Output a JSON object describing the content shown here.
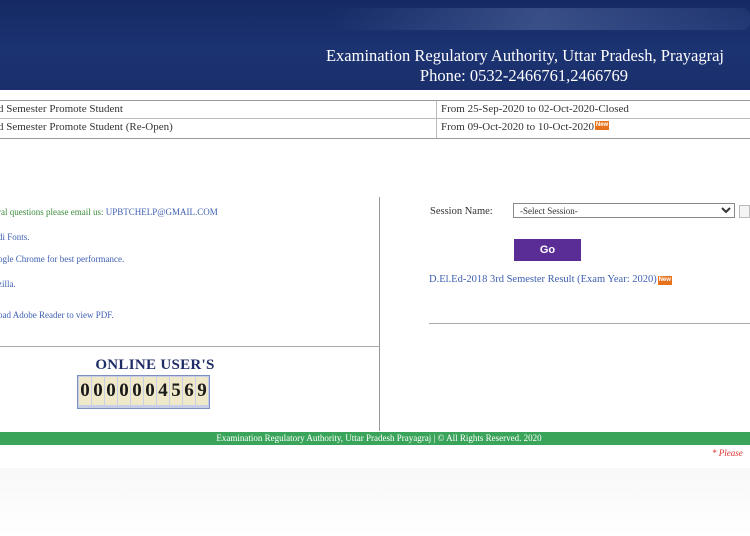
{
  "header": {
    "title": "Examination Regulatory Authority, Uttar Pradesh, Prayagraj",
    "phone": "Phone: 0532-2466761,2466769"
  },
  "schedule": [
    {
      "label": "d Semester Promote Student",
      "dates": "From 25-Sep-2020 to 02-Oct-2020-Closed",
      "new": false
    },
    {
      "label": "d Semester Promote Student (Re-Open)",
      "dates": "From 09-Oct-2020 to 10-Oct-2020",
      "new": true
    }
  ],
  "badge_text": "New",
  "info": {
    "email_text": "ral questions please email us: ",
    "email": "UPBTCHELP@GMAIL.COM",
    "fonts": "di Fonts.",
    "chrome": "ogle Chrome for best performance.",
    "mozilla": "zilla.",
    "adobe": "oad Adobe Reader to view PDF."
  },
  "online": {
    "title": "ONLINE USER'S",
    "digits": [
      "0",
      "0",
      "0",
      "0",
      "0",
      "0",
      "4",
      "5",
      "6",
      "9"
    ]
  },
  "session": {
    "label": "Session Name:",
    "selected": "-Select Session-",
    "go_label": "Go"
  },
  "result_link": "D.El.Ed-2018 3rd Semester Result (Exam Year: 2020)",
  "footer": "Examination Regulatory Authority, Uttar Pradesh Prayagraj | © All Rights Reserved. 2020",
  "notice": "* Please"
}
